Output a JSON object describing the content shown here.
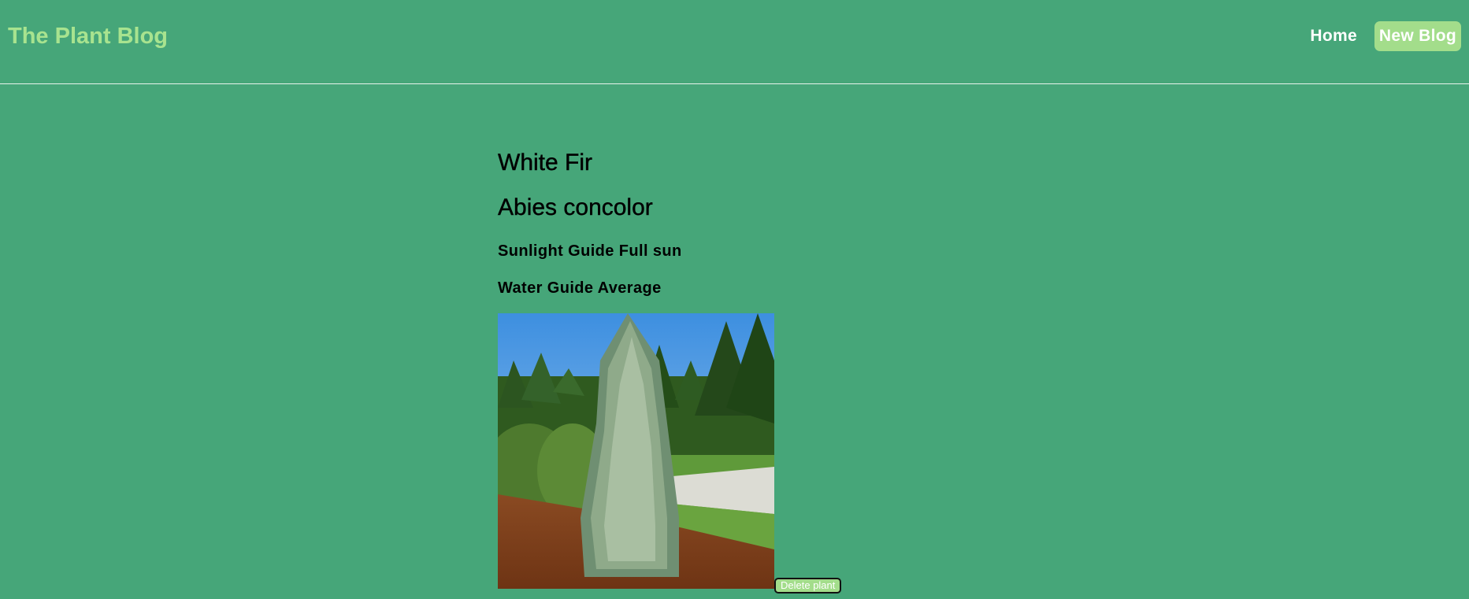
{
  "navbar": {
    "brand": "The Plant Blog",
    "links": [
      {
        "label": "Home"
      },
      {
        "label": "New Blog"
      }
    ]
  },
  "plant": {
    "common_name": "White Fir",
    "scientific_name": "Abies concolor",
    "sunlight": "Sunlight Guide Full sun",
    "water": "Water Guide Average",
    "image_alt": "White Fir tree photo",
    "delete_label": "Delete plant"
  },
  "colors": {
    "background": "#46a679",
    "brand": "#a8e38f",
    "button_bg": "#a3dd8b",
    "text": "#000000"
  }
}
